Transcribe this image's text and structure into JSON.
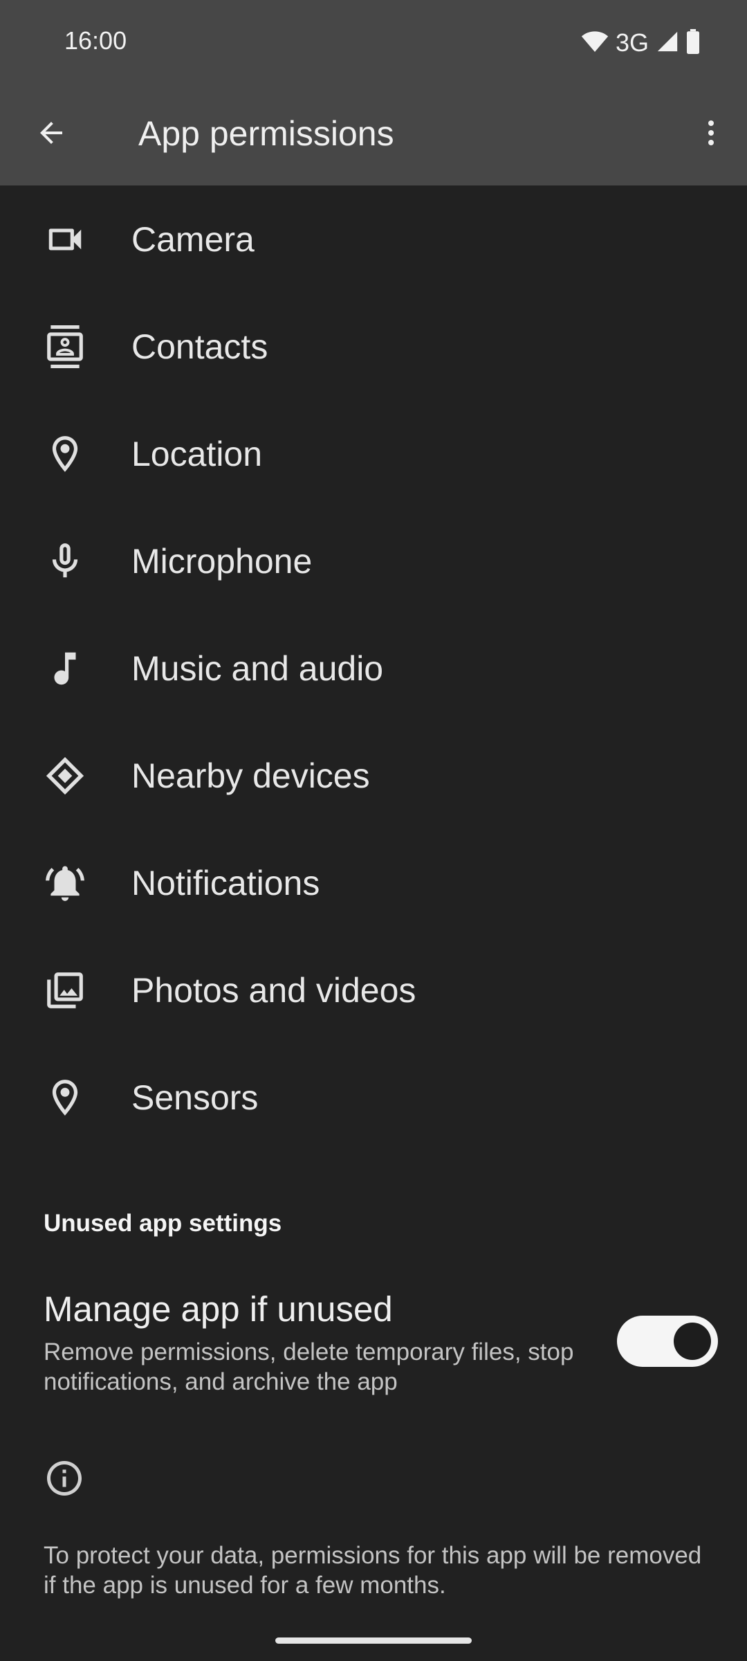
{
  "status_bar": {
    "time": "16:00",
    "network": "3G"
  },
  "app_bar": {
    "title": "App permissions"
  },
  "permissions": [
    {
      "label": "Camera",
      "icon": "camera-icon"
    },
    {
      "label": "Contacts",
      "icon": "contacts-icon"
    },
    {
      "label": "Location",
      "icon": "location-icon"
    },
    {
      "label": "Microphone",
      "icon": "microphone-icon"
    },
    {
      "label": "Music and audio",
      "icon": "music-note-icon"
    },
    {
      "label": "Nearby devices",
      "icon": "nearby-devices-icon"
    },
    {
      "label": "Notifications",
      "icon": "notifications-bell-icon"
    },
    {
      "label": "Photos and videos",
      "icon": "photos-icon"
    },
    {
      "label": "Sensors",
      "icon": "sensors-icon"
    }
  ],
  "unused_section": {
    "header": "Unused app settings",
    "title": "Manage app if unused",
    "description": "Remove permissions, delete temporary files, stop notifications, and archive the app",
    "toggle_on": true
  },
  "info": {
    "text": "To protect your data, permissions for this app will be removed if the app is unused for a few months."
  }
}
